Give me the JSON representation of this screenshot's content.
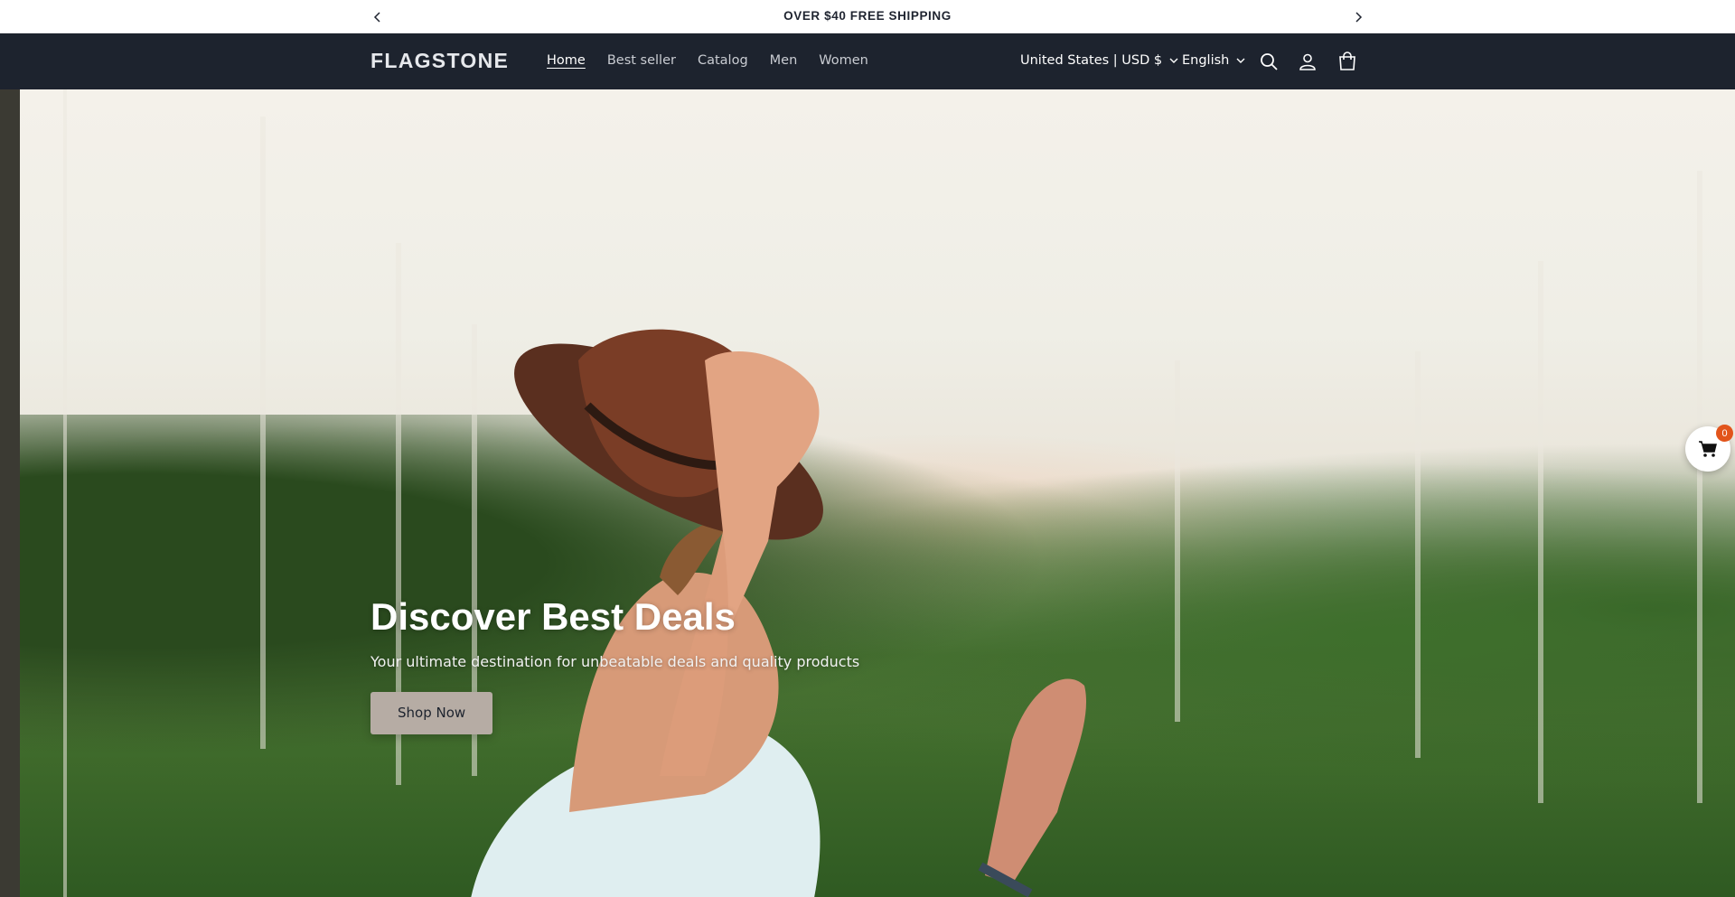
{
  "announcement": {
    "message": "OVER $40 FREE SHIPPING",
    "prev_icon": "chevron-left-icon",
    "next_icon": "chevron-right-icon"
  },
  "header": {
    "logo": "FLAGSTONE",
    "nav": [
      {
        "label": "Home",
        "active": true
      },
      {
        "label": "Best seller"
      },
      {
        "label": "Catalog"
      },
      {
        "label": "Men"
      },
      {
        "label": "Women"
      }
    ],
    "country_selector": "United States | USD $",
    "language_selector": "English",
    "icons": [
      "search-icon",
      "account-icon",
      "cart-icon"
    ],
    "background": "#1d232e"
  },
  "hero": {
    "title": "Discover Best Deals",
    "subtitle": "Your ultimate destination for unbeatable deals and quality products",
    "button_label": "Shop Now",
    "button_color": "#b6aca4"
  },
  "floating_cart": {
    "count": "0",
    "badge_color": "#e2541b"
  }
}
